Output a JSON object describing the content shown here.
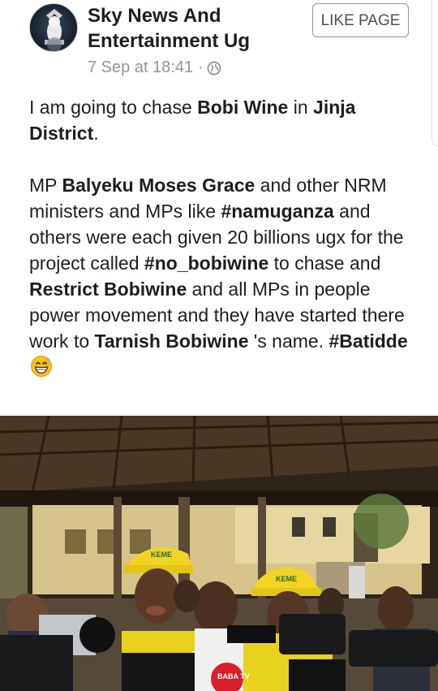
{
  "page": {
    "name": "Sky News And Entertainment Ug",
    "like_label": "LIKE PAGE",
    "timestamp": "7 Sep at 18:41",
    "separator": "·",
    "privacy_icon": "globe-icon",
    "avatar_icon": "page-avatar"
  },
  "post": {
    "p1": {
      "t1": "I am going to chase ",
      "b1": "Bobi Wine",
      "t2": " in ",
      "b2": "Jinja District",
      "t3": "."
    },
    "p2": {
      "t1": " MP ",
      "b1": "Balyeku Moses Grace",
      "t2": " and other NRM ministers and MPs like ",
      "b2": "#namuganza",
      "t3": " and others were each given 20 billions ugx for the project called ",
      "b3": "#no_bobiwine",
      "t4": " to chase and ",
      "b4": "Restrict Bobiwine",
      "t5": " and all MPs in people power movement and they have started there work to ",
      "b5": "Tarnish Bobiwine",
      "t6": " 's name. ",
      "b6": "#Batidde",
      "emoji": "grinning-sweat-emoji"
    }
  },
  "photo": {
    "cap_text_1": "KEME",
    "cap_text_2": "KEME",
    "mic_text": "BABA TV"
  },
  "colors": {
    "meta_gray": "#90949c",
    "cap_yellow": "#f2d422",
    "shirt_yellow": "#e8d21e"
  }
}
